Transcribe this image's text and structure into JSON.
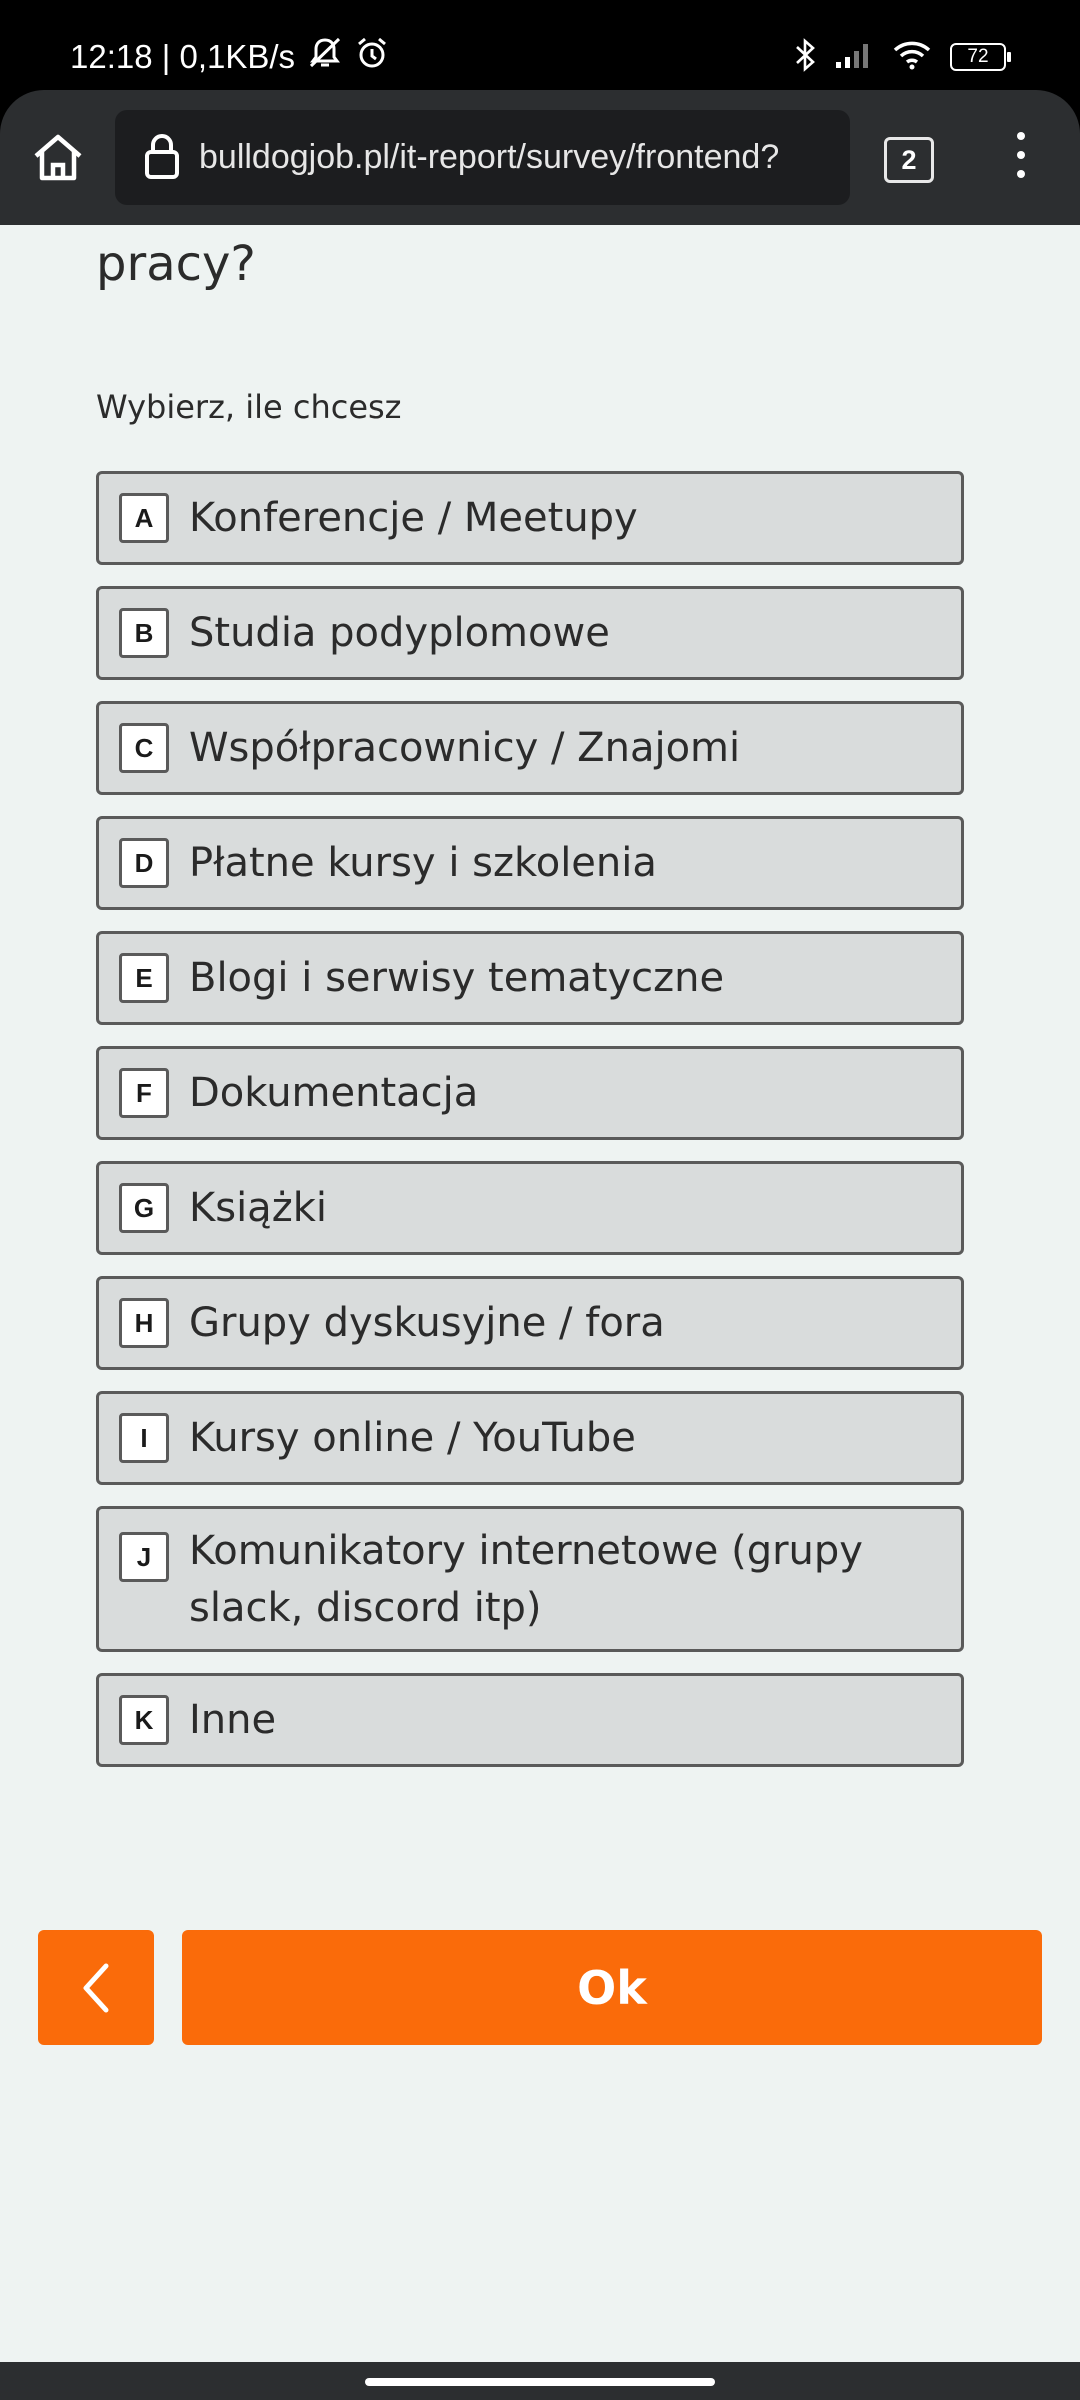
{
  "status_bar": {
    "time_speed": "12:18 | 0,1KB/s",
    "battery": "72"
  },
  "browser": {
    "url": "bulldogjob.pl/it-report/survey/frontend?",
    "tab_count": "2"
  },
  "question": {
    "title_tail": "pracy?",
    "hint": "Wybierz, ile chcesz"
  },
  "options": [
    {
      "key": "A",
      "label": "Konferencje / Meetupy"
    },
    {
      "key": "B",
      "label": "Studia podyplomowe"
    },
    {
      "key": "C",
      "label": "Współpracownicy / Znajomi"
    },
    {
      "key": "D",
      "label": "Płatne kursy i szkolenia"
    },
    {
      "key": "E",
      "label": "Blogi i serwisy tematyczne"
    },
    {
      "key": "F",
      "label": "Dokumentacja"
    },
    {
      "key": "G",
      "label": "Książki"
    },
    {
      "key": "H",
      "label": "Grupy dyskusyjne / fora"
    },
    {
      "key": "I",
      "label": "Kursy online / YouTube"
    },
    {
      "key": "J",
      "label": "Komunikatory internetowe (grupy slack, discord itp)"
    },
    {
      "key": "K",
      "label": "Inne"
    }
  ],
  "actions": {
    "ok_label": "Ok"
  },
  "colors": {
    "accent": "#fa6b0a",
    "background": "#eef3f2",
    "option_bg": "#d9dcdc"
  }
}
